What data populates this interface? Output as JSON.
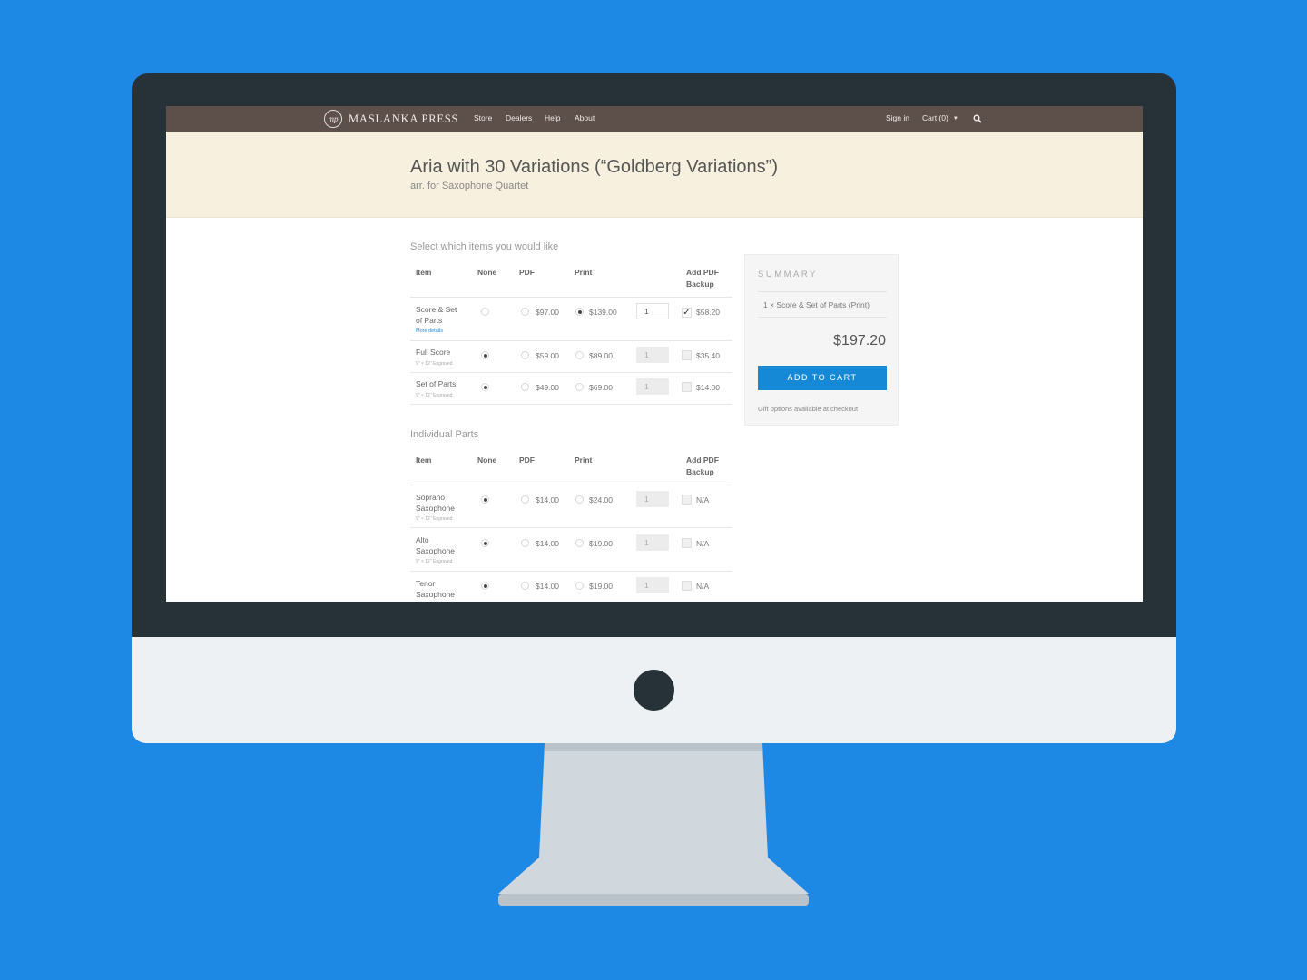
{
  "colors": {
    "background": "#1e88e5",
    "navbar": "#5d4f4a",
    "hero": "#f7f0df",
    "accent": "#1589d6"
  },
  "nav": {
    "logo_mark": "mp",
    "logo_text": "MASLANKA PRESS",
    "links": [
      "Store",
      "Dealers",
      "Help",
      "About"
    ],
    "sign_in": "Sign in",
    "cart": "Cart (0)",
    "search_icon": "search-icon"
  },
  "hero": {
    "title": "Aria with 30 Variations (“Goldberg Variations”)",
    "subtitle": "arr. for Saxophone Quartet"
  },
  "main": {
    "select_label": "Select which items you would like",
    "individual_label": "Individual Parts",
    "columns": {
      "item": "Item",
      "none": "None",
      "pdf": "PDF",
      "print": "Print",
      "backup_1": "Add PDF",
      "backup_2": "Backup"
    },
    "items": [
      {
        "name_1": "Score & Set",
        "name_2": "of Parts",
        "link": "More details",
        "selected": "print",
        "pdf": "$97.00",
        "print": "$139.00",
        "qty": "1",
        "backup": "$58.20",
        "backup_checked": true
      },
      {
        "name_1": "Full Score",
        "note": "9\" × 12\" Engraved",
        "selected": "none",
        "pdf": "$59.00",
        "print": "$89.00",
        "qty": "1",
        "backup": "$35.40",
        "backup_checked": false
      },
      {
        "name_1": "Set of Parts",
        "note": "9\" × 12\" Engraved",
        "selected": "none",
        "pdf": "$49.00",
        "print": "$69.00",
        "qty": "1",
        "backup": "$14.00",
        "backup_checked": false
      }
    ],
    "parts": [
      {
        "name_1": "Soprano",
        "name_2": "Saxophone",
        "note": "9\" × 12\" Engraved",
        "selected": "none",
        "pdf": "$14.00",
        "print": "$24.00",
        "qty": "1",
        "backup": "N/A"
      },
      {
        "name_1": "Alto",
        "name_2": "Saxophone",
        "note": "9\" × 12\" Engraved",
        "selected": "none",
        "pdf": "$14.00",
        "print": "$19.00",
        "qty": "1",
        "backup": "N/A"
      },
      {
        "name_1": "Tenor",
        "name_2": "Saxophone",
        "selected": "none",
        "pdf": "$14.00",
        "print": "$19.00",
        "qty": "1",
        "backup": "N/A"
      }
    ]
  },
  "summary": {
    "title": "SUMMARY",
    "line_item": "1 × Score & Set of Parts (Print)",
    "total": "$197.20",
    "button": "ADD TO CART",
    "note": "Gift options available at checkout"
  }
}
